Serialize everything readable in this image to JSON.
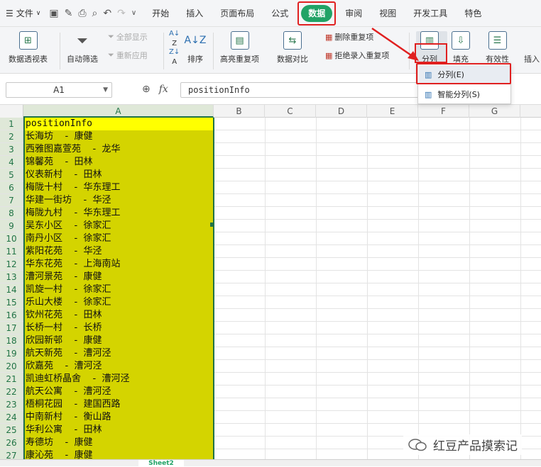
{
  "menubar": {
    "file_label": "文件",
    "tabs": [
      "开始",
      "插入",
      "页面布局",
      "公式",
      "数据",
      "审阅",
      "视图",
      "开发工具",
      "特色"
    ]
  },
  "ribbon": {
    "pivot": "数据透视表",
    "autofilter": "自动筛选",
    "show_all": "全部显示",
    "reapply": "重新应用",
    "sort": "排序",
    "highlight_dup": "高亮重复项",
    "compare": "数据对比",
    "remove_dup": "删除重复项",
    "reject_dup": "拒绝录入重复项",
    "split": "分列",
    "fill": "填充",
    "validity": "有效性",
    "insert": "插入"
  },
  "dropdown": {
    "split": "分列(E)",
    "smart_split": "智能分列(S)"
  },
  "formula": {
    "cell_ref": "A1",
    "content": "positionInfo"
  },
  "columns": [
    "A",
    "B",
    "C",
    "D",
    "E",
    "F",
    "G"
  ],
  "rows": [
    "positionInfo",
    "长海坊    -  康健",
    "西雅图嘉萱苑    -  龙华",
    "锦馨苑    -  田林",
    "仪表新村    -  田林",
    "梅陇十村    -  华东理工",
    "华建一街坊    -  华泾",
    "梅陇九村    -  华东理工",
    "吴东小区    -  徐家汇",
    "南丹小区    -  徐家汇",
    "紫阳花苑    -  华泾",
    "华东花苑    -  上海南站",
    "漕河景苑    -  康健",
    "凯旋一村    -  徐家汇",
    "乐山大楼    -  徐家汇",
    "钦州花苑    -  田林",
    "长桥一村    -  长桥",
    "欣园新邨    -  康健",
    "航天新苑    -  漕河泾",
    "欣嘉苑    -  漕河泾",
    "凯迪虹桥晶舍    -  漕河泾",
    "航天公寓    -  漕河泾",
    "梧桐花园    -  建国西路",
    "中南新村    -  衡山路",
    "华利公寓    -  田林",
    "寿德坊    -  康健",
    "康沁苑    -  康健"
  ],
  "sheet": {
    "tab_label": "Sheet2"
  },
  "watermark": {
    "text": "红豆产品摸索记"
  },
  "colors": {
    "accent": "#21a366",
    "highlight_red": "#e02020",
    "cell_fill": "#d4d400",
    "active_cell": "#ffff00"
  }
}
